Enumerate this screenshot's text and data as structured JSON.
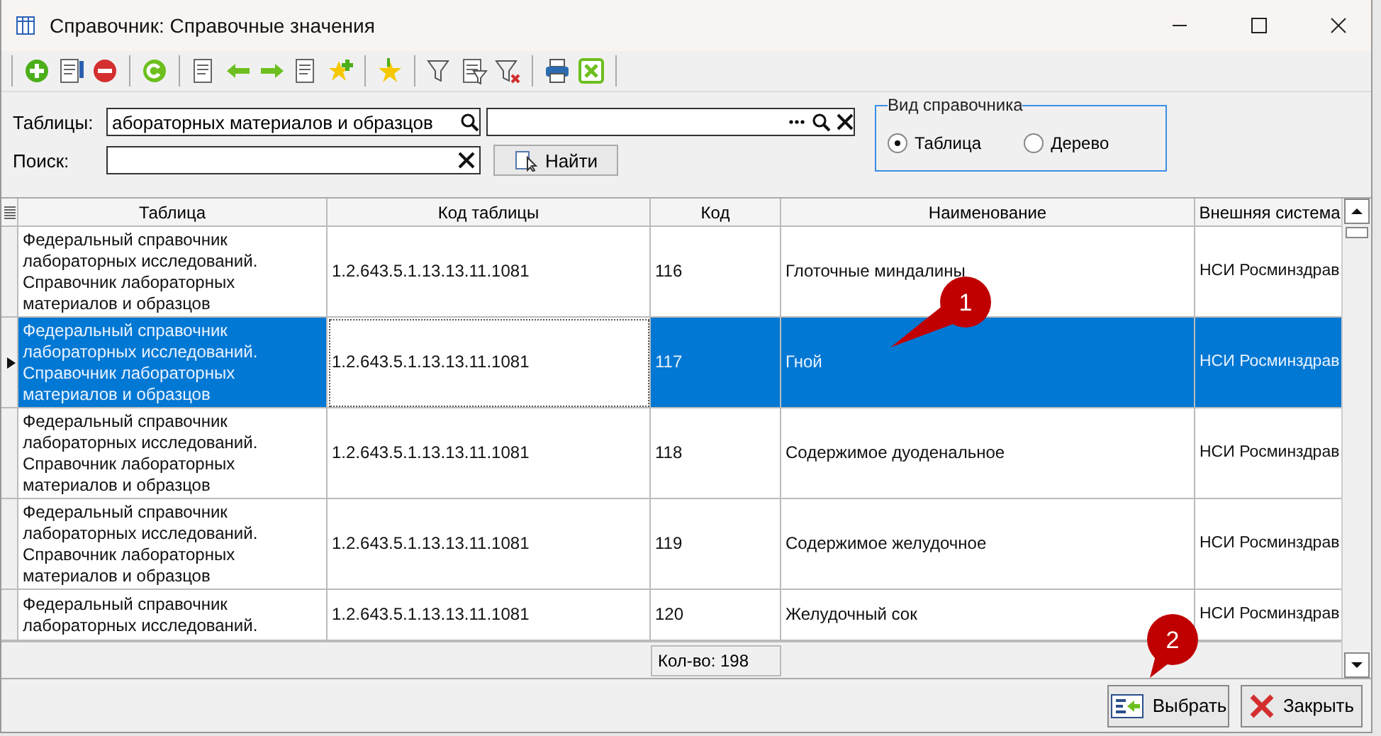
{
  "window": {
    "title": "Справочник: Справочные значения"
  },
  "filters": {
    "tables_label": "Таблицы:",
    "tables_value": "абораторных материалов и образцов",
    "search_label": "Поиск:",
    "find_button": "Найти"
  },
  "view_group": {
    "title": "Вид справочника",
    "options": [
      {
        "label": "Таблица",
        "selected": true
      },
      {
        "label": "Дерево",
        "selected": false
      }
    ]
  },
  "table": {
    "columns": [
      {
        "label": "Таблица",
        "focused": false
      },
      {
        "label": "Код таблицы",
        "focused": true
      },
      {
        "label": "Код",
        "focused": false
      },
      {
        "label": "Наименование",
        "focused": false
      },
      {
        "label": "Внешняя система",
        "focused": false
      }
    ],
    "rows": [
      {
        "selected": false,
        "cells": [
          "Федеральный справочник лабораторных исследований. Справочник лабораторных материалов и образцов",
          "1.2.643.5.1.13.13.11.1081",
          "116",
          "Глоточные миндалины",
          "НСИ Росминздрав"
        ]
      },
      {
        "selected": true,
        "cells": [
          "Федеральный справочник лабораторных исследований. Справочник лабораторных материалов и образцов",
          "1.2.643.5.1.13.13.11.1081",
          "117",
          "Гной",
          "НСИ Росминздрав"
        ]
      },
      {
        "selected": false,
        "cells": [
          "Федеральный справочник лабораторных исследований. Справочник лабораторных материалов и образцов",
          "1.2.643.5.1.13.13.11.1081",
          "118",
          "Содержимое дуоденальное",
          "НСИ Росминздрав"
        ]
      },
      {
        "selected": false,
        "cells": [
          "Федеральный справочник лабораторных исследований. Справочник лабораторных материалов и образцов",
          "1.2.643.5.1.13.13.11.1081",
          "119",
          "Содержимое желудочное",
          "НСИ Росминздрав"
        ]
      },
      {
        "selected": false,
        "cells": [
          "Федеральный справочник лабораторных исследований.",
          "1.2.643.5.1.13.13.11.1081",
          "120",
          "Желудочный сок",
          "НСИ Росминздрав"
        ]
      }
    ],
    "count": "Кол-во: 198"
  },
  "buttons": [
    {
      "label": "Выбрать",
      "kind": "select"
    },
    {
      "label": "Закрыть",
      "kind": "close"
    }
  ],
  "callouts": [
    {
      "text": "1",
      "kind": "row"
    },
    {
      "text": "2",
      "kind": "button"
    }
  ]
}
